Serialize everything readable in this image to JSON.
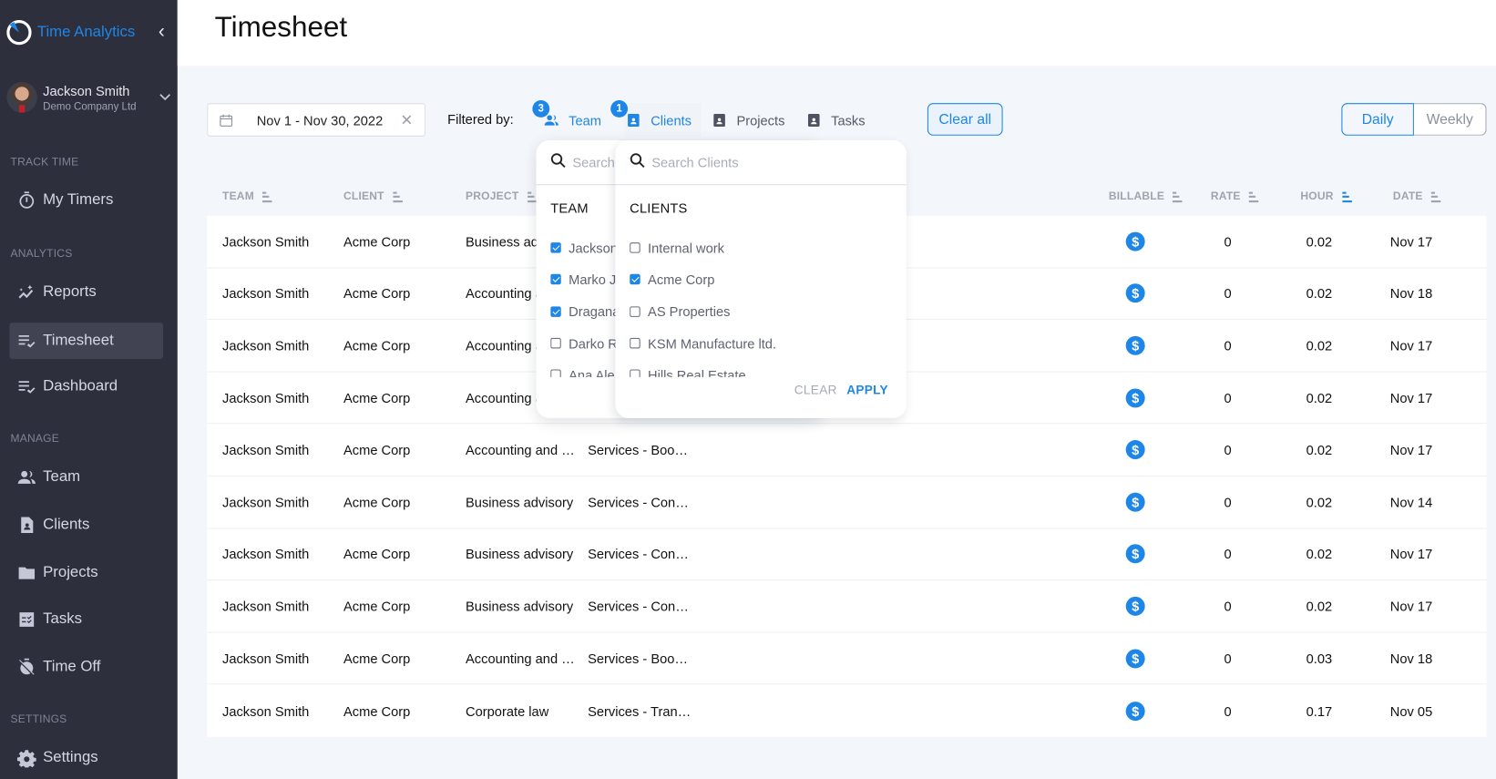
{
  "app": {
    "name": "Time Analytics"
  },
  "user": {
    "name": "Jackson Smith",
    "company": "Demo Company Ltd"
  },
  "sidebar": {
    "sections": [
      {
        "label": "TRACK TIME"
      },
      {
        "label": "ANALYTICS"
      },
      {
        "label": "MANAGE"
      },
      {
        "label": "SETTINGS"
      }
    ],
    "items": [
      {
        "label": "My Timers",
        "icon": "stopwatch-icon"
      },
      {
        "label": "Reports",
        "icon": "reports-icon"
      },
      {
        "label": "Timesheet",
        "icon": "timesheet-icon",
        "active": true
      },
      {
        "label": "Dashboard",
        "icon": "dashboard-icon"
      },
      {
        "label": "Team",
        "icon": "team-icon"
      },
      {
        "label": "Clients",
        "icon": "clients-icon"
      },
      {
        "label": "Projects",
        "icon": "folder-icon"
      },
      {
        "label": "Tasks",
        "icon": "tasks-icon"
      },
      {
        "label": "Time Off",
        "icon": "time-off-icon"
      },
      {
        "label": "Settings",
        "icon": "gear-icon"
      }
    ]
  },
  "header": {
    "title": "Timesheet"
  },
  "toolbar": {
    "date_range": "Nov 1 - Nov 30, 2022",
    "filtered_by_label": "Filtered by:",
    "filters": [
      {
        "label": "Team",
        "count": "3",
        "active": true
      },
      {
        "label": "Clients",
        "count": "1",
        "active": true
      },
      {
        "label": "Projects",
        "active": false
      },
      {
        "label": "Tasks",
        "active": false
      }
    ],
    "clear_all_label": "Clear all",
    "views": [
      {
        "label": "Daily",
        "selected": true
      },
      {
        "label": "Weekly",
        "selected": false
      }
    ]
  },
  "table": {
    "columns": [
      "TEAM",
      "CLIENT",
      "PROJECT",
      "BILLABLE",
      "RATE",
      "HOUR",
      "DATE"
    ],
    "active_sort": "HOUR",
    "rows": [
      {
        "team": "Jackson Smith",
        "client": "Acme Corp",
        "project": "Business advisory",
        "task": "",
        "billable": true,
        "rate": "0",
        "hour": "0.02",
        "date": "Nov 17"
      },
      {
        "team": "Jackson Smith",
        "client": "Acme Corp",
        "project": "Accounting and …",
        "task": "",
        "billable": true,
        "rate": "0",
        "hour": "0.02",
        "date": "Nov 18"
      },
      {
        "team": "Jackson Smith",
        "client": "Acme Corp",
        "project": "Accounting and …",
        "task": "",
        "billable": true,
        "rate": "0",
        "hour": "0.02",
        "date": "Nov 17"
      },
      {
        "team": "Jackson Smith",
        "client": "Acme Corp",
        "project": "Accounting and …",
        "task": "",
        "billable": true,
        "rate": "0",
        "hour": "0.02",
        "date": "Nov 17"
      },
      {
        "team": "Jackson Smith",
        "client": "Acme Corp",
        "project": "Accounting and …",
        "task": "Services - Bookk…",
        "billable": true,
        "rate": "0",
        "hour": "0.02",
        "date": "Nov 17"
      },
      {
        "team": "Jackson Smith",
        "client": "Acme Corp",
        "project": "Business advisory",
        "task": "Services - Consu…",
        "billable": true,
        "rate": "0",
        "hour": "0.02",
        "date": "Nov 14"
      },
      {
        "team": "Jackson Smith",
        "client": "Acme Corp",
        "project": "Business advisory",
        "task": "Services - Consu…",
        "billable": true,
        "rate": "0",
        "hour": "0.02",
        "date": "Nov 17"
      },
      {
        "team": "Jackson Smith",
        "client": "Acme Corp",
        "project": "Business advisory",
        "task": "Services - Consu…",
        "billable": true,
        "rate": "0",
        "hour": "0.02",
        "date": "Nov 17"
      },
      {
        "team": "Jackson Smith",
        "client": "Acme Corp",
        "project": "Accounting and …",
        "task": "Services - Bookk…",
        "billable": true,
        "rate": "0",
        "hour": "0.03",
        "date": "Nov 18"
      },
      {
        "team": "Jackson Smith",
        "client": "Acme Corp",
        "project": "Corporate law",
        "task": "Services - Transf…",
        "billable": true,
        "rate": "0",
        "hour": "0.17",
        "date": "Nov 05"
      }
    ]
  },
  "team_dropdown": {
    "search_placeholder": "Search Team",
    "title": "TEAM",
    "items": [
      {
        "label": "Jackson Smith",
        "checked": true
      },
      {
        "label": "Marko J",
        "checked": true
      },
      {
        "label": "Dragana",
        "checked": true
      },
      {
        "label": "Darko R",
        "checked": false
      },
      {
        "label": "Ana Alek",
        "checked": false
      }
    ]
  },
  "clients_dropdown": {
    "search_placeholder": "Search Clients",
    "title": "CLIENTS",
    "items": [
      {
        "label": "Internal work",
        "checked": false
      },
      {
        "label": "Acme Corp",
        "checked": true
      },
      {
        "label": "AS Properties",
        "checked": false
      },
      {
        "label": "KSM Manufacture ltd.",
        "checked": false
      },
      {
        "label": "Hills Real Estate",
        "checked": false
      }
    ],
    "clear_label": "CLEAR",
    "apply_label": "APPLY"
  },
  "colors": {
    "accent": "#1e86e6",
    "sidebar_bg": "#2e2f3d",
    "page_bg": "#f3f6fa"
  }
}
